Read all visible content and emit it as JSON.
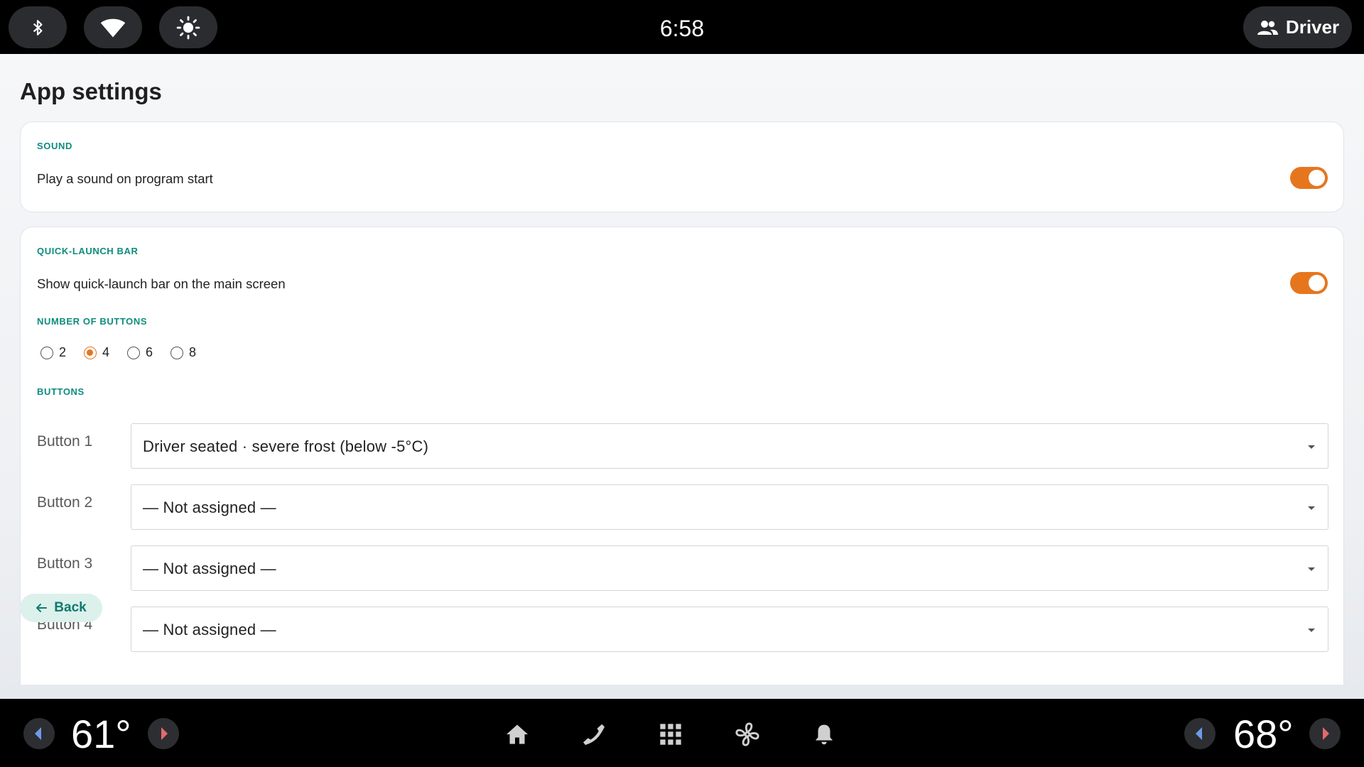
{
  "status_bar": {
    "time": "6:58",
    "profile_label": "Driver",
    "icons": [
      "bluetooth-icon",
      "wifi-icon",
      "brightness-icon",
      "people-icon"
    ]
  },
  "page": {
    "title": "App settings"
  },
  "sound": {
    "section_label": "SOUND",
    "setting_label": "Play a sound on program start",
    "enabled": true
  },
  "quick_launch": {
    "section_label": "QUICK-LAUNCH BAR",
    "setting_label": "Show quick-launch bar on the main screen",
    "enabled": true,
    "count_label": "NUMBER OF BUTTONS",
    "count_options": [
      "2",
      "4",
      "6",
      "8"
    ],
    "count_selected": "4",
    "buttons_label": "BUTTONS",
    "buttons": [
      {
        "label": "Button 1",
        "value": "Driver seated · severe frost (below -5°C)"
      },
      {
        "label": "Button 2",
        "value": "— Not assigned —"
      },
      {
        "label": "Button 3",
        "value": "— Not assigned —"
      },
      {
        "label": "Button 4",
        "value": "— Not assigned —"
      }
    ]
  },
  "footer": {
    "back_label": "Back"
  },
  "nav_bar": {
    "left_temp": "61°",
    "right_temp": "68°",
    "icons": [
      "home-icon",
      "phone-icon",
      "apps-grid-icon",
      "fan-icon",
      "bell-icon"
    ]
  },
  "colors": {
    "accent": "#e6761e",
    "section_label": "#0d8c7d",
    "back_button_bg": "#dcf1ec"
  }
}
